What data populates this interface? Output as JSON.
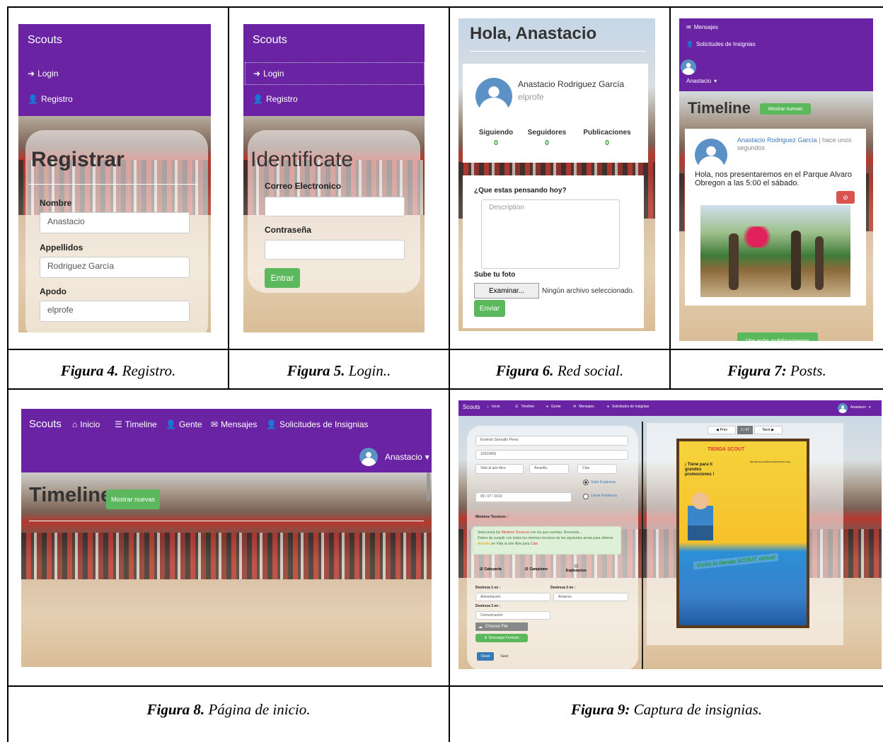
{
  "captions": {
    "fig4": {
      "num": "Figura 4.",
      "text": " Registro."
    },
    "fig5": {
      "num": "Figura 5.",
      "text": " Login.."
    },
    "fig6": {
      "num": "Figura 6.",
      "text": " Red social."
    },
    "fig7": {
      "num": "Figura 7:",
      "text": " Posts."
    },
    "fig8": {
      "num": "Figura 8.",
      "text": " Página de inicio."
    },
    "fig9": {
      "num": "Figura 9:",
      "text": " Captura de insignias."
    }
  },
  "fig4": {
    "brand": "Scouts",
    "login": "Login",
    "registro": "Registro",
    "title": "Registrar",
    "nombre_label": "Nombre",
    "nombre_value": "Anastacio",
    "apellidos_label": "Appellidos",
    "apellidos_value": "Rodriguez García",
    "apodo_label": "Apodo",
    "apodo_value": "elprofe"
  },
  "fig5": {
    "brand": "Scouts",
    "login": "Login",
    "registro": "Registro",
    "title": "Identificate",
    "correo_label": "Correo Electronico",
    "pass_label": "Contraseña",
    "submit": "Entrar"
  },
  "fig6": {
    "greeting": "Hola, Anastacio",
    "name": "Anastacio Rodriguez García",
    "nick": "elprofe",
    "stats": [
      {
        "label": "Siguiendo",
        "value": "0"
      },
      {
        "label": "Seguidores",
        "value": "0"
      },
      {
        "label": "Publicaciones",
        "value": "0"
      }
    ],
    "prompt": "¿Que estas pensando hoy?",
    "placeholder": "Description",
    "photo_label": "Sube tu foto",
    "browse": "Examinar...",
    "no_file": "Ningún archivo seleccionado.",
    "send": "Enviar"
  },
  "fig7": {
    "mensajes": "Mensajes",
    "solicitudes": "Solicitudes de Insignias",
    "user": "Anastacio",
    "title": "Timeline",
    "new_btn": "Mostrar nuevas",
    "author": "Anastacio Rodriguez García",
    "sep": "|",
    "time": "hace unos segundos",
    "post_text": "Hola, nos presentaremos en el Parque Alvaro Obregon a las 5:00 el sábado.",
    "more": "Ver más publicaciones"
  },
  "fig8": {
    "brand": "Scouts",
    "nav": [
      "Inicio",
      "Timeline",
      "Gente",
      "Mensajes",
      "Solicitudes de Insignias"
    ],
    "user": "Anastacio",
    "title": "Timeline",
    "new_btn": "Mostrar nuevas"
  },
  "fig9": {
    "brand": "Scouts",
    "nav": [
      "Inicio",
      "Timeline",
      "Gente",
      "Mensajes",
      "Solicitudes de Insignias"
    ],
    "user": "Anastacio",
    "name_value": "Evaristo Samudio Perez",
    "id_value": "10323455",
    "sel1": "Vida al aire libre",
    "sel2": "Amarilla",
    "sel3": "Clan",
    "radio1": "Subir Evidencia",
    "radio2": "Llenar Evidencia",
    "date": "09 / 07 / 2019",
    "minimos_label": "Minimos Tecnicos :",
    "alert1": "Selecciona los",
    "alert_hl": "Minimos Tecnicos",
    "alert2": "con los que cuentas. Recuerda...",
    "alert3": "Debes de cumplir con todos los minimos tecnicos de las siguientes areas para obtener",
    "alert_hl2": "Amarilla",
    "alert4": "en Vida al aire libre para",
    "alert_hl3": "Clan",
    "chk1": "Cabuyeria",
    "chk2": "Campismo",
    "chk3": "Exploracion",
    "d1_label": "Destreza 1 en :",
    "d1_value": "Alimentación",
    "d2_label": "Destreza 2 en :",
    "d2_value": "Amarres",
    "d3_label": "Destreza 3 en :",
    "d3_value": "Comunicación",
    "choose": "Choose File",
    "download": "Descargar Formato",
    "clean": "Clean",
    "save": "Save",
    "prev": "Prev",
    "page": "1 / 47",
    "next": "Next",
    "poster_brand": "TIENDA SCOUT",
    "poster_promo": "¡ Tiene para ti grandes promociones !",
    "poster_banner": "Visita la tienda SCOUT virtual",
    "poster_email": "tienda.scout@scoutsmexico.org"
  }
}
